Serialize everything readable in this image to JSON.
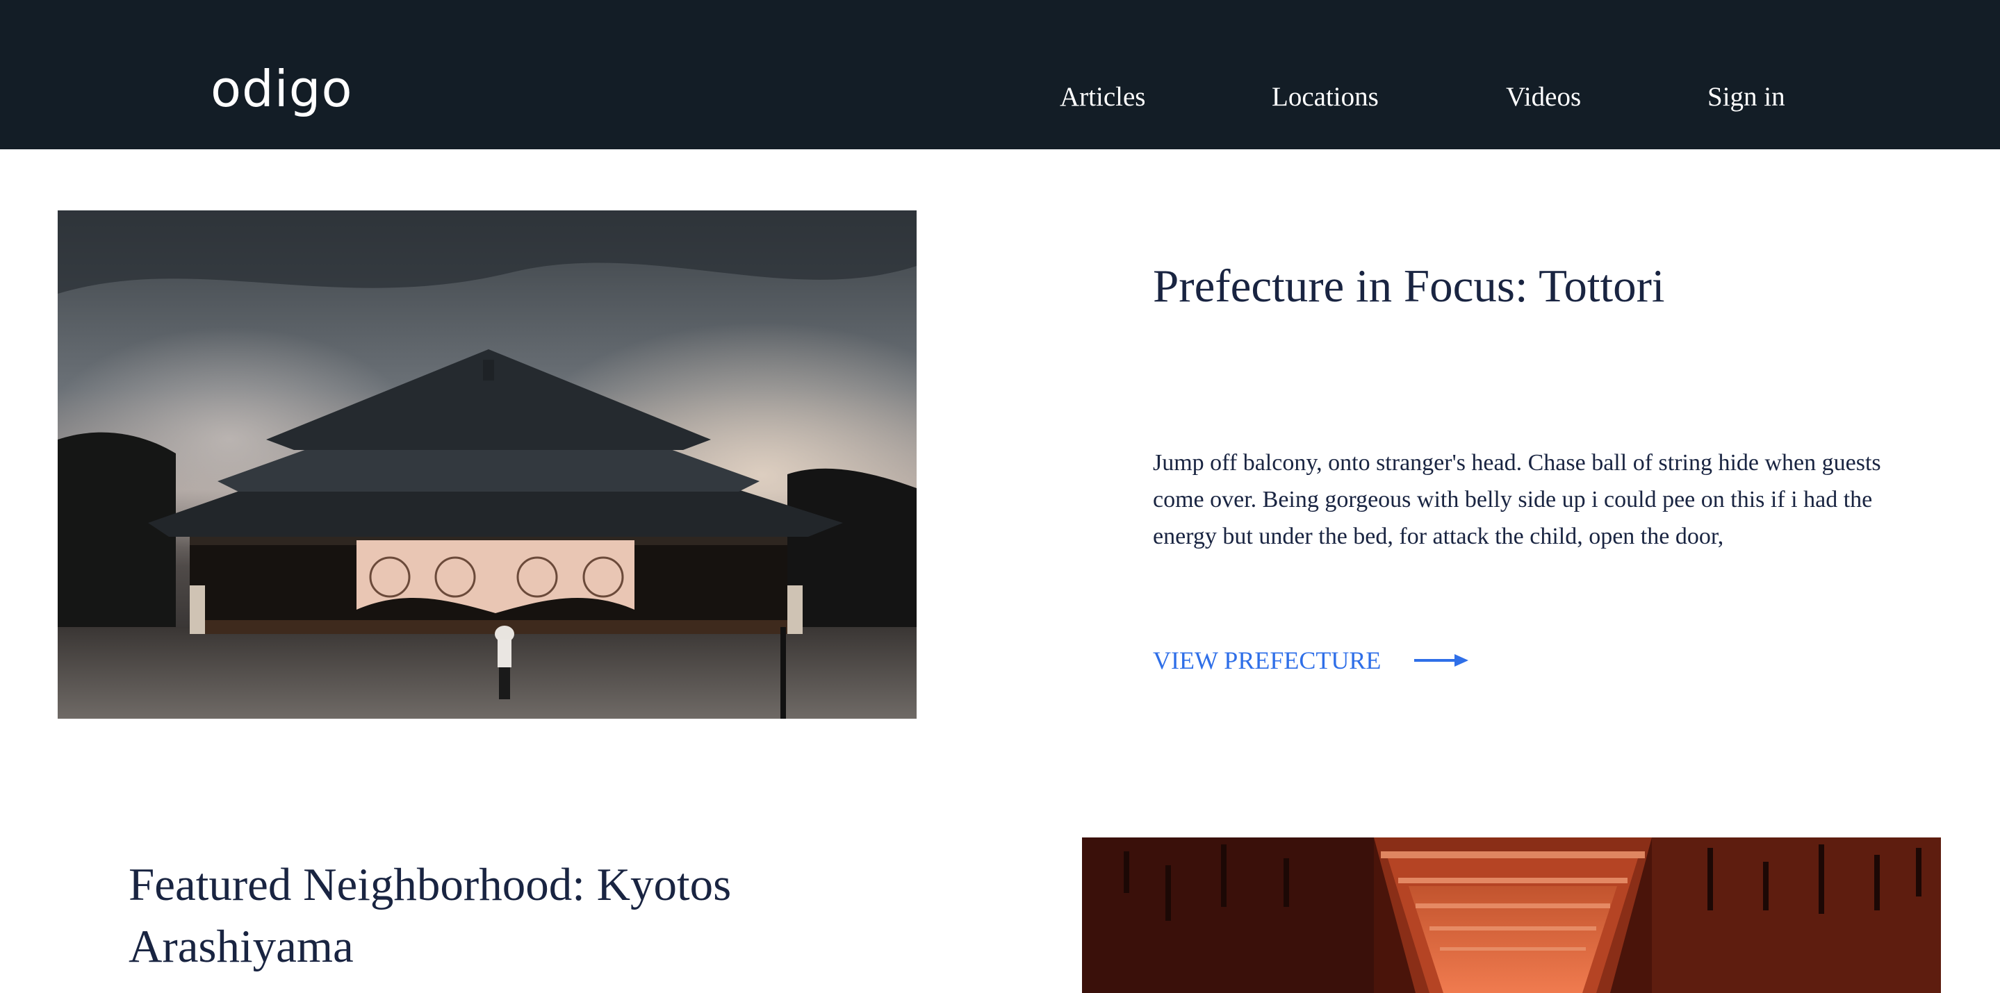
{
  "header": {
    "logo_text": "odigo",
    "nav": {
      "articles": "Articles",
      "locations": "Locations",
      "videos": "Videos",
      "sign_in": "Sign in"
    }
  },
  "featured_prefecture": {
    "image_icon": "shrine-photo",
    "title": "Prefecture in Focus: Tottori",
    "body": "Jump off balcony, onto stranger's head. Chase ball of string hide when guests come over. Being gorgeous with belly side up i could pee on this if i had the energy but under the bed, for attack the child, open the door,",
    "cta_label": "VIEW PREFECTURE",
    "cta_icon": "arrow-right-icon"
  },
  "featured_neighborhood": {
    "title": "Featured Neighborhood: Kyotos Arashiyama",
    "image_icon": "torii-gates-photo"
  },
  "colors": {
    "header_bg": "#131d26",
    "heading": "#192441",
    "accent": "#2f6fe8"
  }
}
